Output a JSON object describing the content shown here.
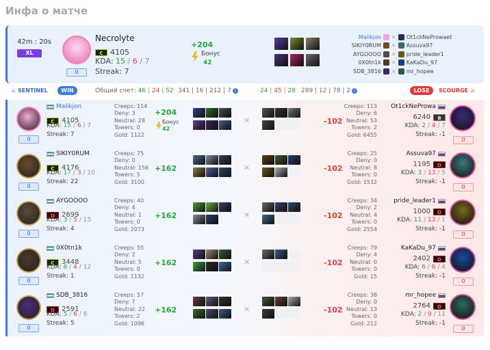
{
  "page": {
    "title": "Инфа о матче"
  },
  "summary": {
    "time": "42m : 20s",
    "badge": "XL",
    "hero": "Necrolyte",
    "rank": "C",
    "mmr": "4105",
    "kda_label": "KDA:",
    "kda_k": "15",
    "kda_d": "6",
    "kda_a": "7",
    "sep": "/",
    "streak": "Streak: 7",
    "zero": "0",
    "delta": "+204",
    "bonus_label": "Бонус",
    "bonus_value": "42",
    "colors": {
      "accent": "#3d7be0",
      "positive": "#22a83a",
      "negative": "#e23b3b",
      "xl_badge": "#7b3ee6"
    },
    "items": [
      "#5b3aa8",
      "#7c8a2a",
      "#8a7a6a",
      "#4a2e7a",
      "#b0205a",
      "#6a6a6a"
    ],
    "lineup": [
      {
        "left": "Malikjon",
        "right": "Ot1ckNeProwaet",
        "la": "#f3a9d5",
        "ra": "#2a2a5a",
        "highlight": true
      },
      {
        "left": "SIKIY0RUM",
        "right": "Assuva97",
        "la": "#6a4a2a",
        "ra": "#3a6a6a",
        "highlight": false
      },
      {
        "left": "AYGOOOO",
        "right": "pride_leader1",
        "la": "#5a4a3a",
        "ra": "#6a5a1a",
        "highlight": false
      },
      {
        "left": "0X0tn1k",
        "right": "KaKaDu_97",
        "la": "#4a3a2a",
        "ra": "#1a3a8a",
        "highlight": false
      },
      {
        "left": "SDB_3816",
        "right": "mr_hopee",
        "la": "#3a2a6a",
        "ra": "#2a5a4a",
        "highlight": false
      }
    ]
  },
  "scorebar": {
    "sentinel": "SENTINEL",
    "win": "WIN",
    "total_label": "Общий счет:",
    "s_k": "46",
    "s_d": "24",
    "s_a": "52",
    "s_totals": "341 | 16 | 212 | 7",
    "c_k": "24",
    "c_d": "45",
    "c_a": "28",
    "c_totals": "289 | 12 | 78 | 2",
    "lose": "LOSE",
    "scourge": "SCOURGE",
    "bar": "|"
  },
  "labels": {
    "creeps": "Creeps:",
    "deny": "Deny:",
    "neutral": "Neutral:",
    "towers": "Towers:",
    "gold": "Gold:",
    "kda": "KDA:",
    "streak": "Streak:",
    "bonus": "Бонус"
  },
  "players": [
    {
      "left": {
        "name": "Malikjon",
        "link": true,
        "rank": "C",
        "mmr": "4105",
        "k": "15",
        "d": "6",
        "a": "7",
        "streak": "7",
        "zero": "0",
        "creeps": "114",
        "deny": "3",
        "neutral": "28",
        "towers": "0",
        "gold": "1122",
        "delta": "+204",
        "bonus": "42",
        "avatar": "#f3a9d5",
        "items": [
          "#3a3a8a",
          "#2a6a2a",
          "#4a4a4a",
          "#6a3a8a",
          "#3a2a5a",
          "#4a5a8a"
        ]
      },
      "right": {
        "name": "Ot1ckNeProwa",
        "rank": "B",
        "mmr": "6240",
        "k": "2",
        "d": "4",
        "a": "7",
        "streak": "-1",
        "zero": "0",
        "creeps": "113",
        "deny": "6",
        "neutral": "53",
        "towers": "2",
        "gold": "6455",
        "delta": "-102",
        "avatar": "#3a2a7a",
        "items": [
          "#555555",
          "#333333",
          "#777777",
          "#444444"
        ]
      }
    },
    {
      "left": {
        "name": "SIKIY0RUM",
        "link": false,
        "rank": "C",
        "mmr": "4176",
        "k": "17",
        "d": "3",
        "a": "10",
        "streak": "22",
        "zero": "0",
        "creeps": "75",
        "deny": "0",
        "neutral": "156",
        "towers": "5",
        "gold": "3100",
        "delta": "+162",
        "avatar": "#6a4a2a",
        "items": [
          "#4a6a8a",
          "#7a8aa0",
          "#3a3a5a",
          "#8a7a3a",
          "#5a5aa0",
          "#2a4a6a"
        ]
      },
      "right": {
        "name": "Assuva97",
        "rank": "D",
        "mmr": "1195",
        "k": "3",
        "d": "13",
        "a": "5",
        "streak": "-1",
        "zero": "0",
        "creeps": "25",
        "deny": "0",
        "neutral": "8",
        "towers": "0",
        "gold": "1532",
        "delta": "-102",
        "avatar": "#3a7a7a",
        "items": [
          "#5a3a1a",
          "#3a5a2a",
          "#2a3a7a",
          "#6a5a1a",
          "#aaaaaa"
        ]
      }
    },
    {
      "left": {
        "name": "AYGOOOO",
        "link": false,
        "rank": "D",
        "mmr": "2699",
        "k": "3",
        "d": "5",
        "a": "15",
        "streak": "4",
        "zero": "0",
        "creeps": "40",
        "deny": "4",
        "neutral": "1",
        "towers": "0",
        "gold": "2073",
        "delta": "+162",
        "avatar": "#5a4a3a",
        "items": [
          "#4aa03a",
          "#6ab04a",
          "#3a3a6a",
          "#8a8a8a",
          "#2a3a6a"
        ]
      },
      "right": {
        "name": "pride_leader1",
        "rank": "D",
        "mmr": "1000",
        "k": "11",
        "d": "13",
        "a": "1",
        "streak": "-1",
        "zero": "0",
        "creeps": "34",
        "deny": "2",
        "neutral": "4",
        "towers": "0",
        "gold": "2554",
        "delta": "-102",
        "avatar": "#7a6a1a",
        "items": [
          "#6a6a6a",
          "#3a3a6a",
          "#2a4a6a",
          "#3a6a8a"
        ]
      }
    },
    {
      "left": {
        "name": "0X0tn1k",
        "link": false,
        "rank": "C",
        "mmr": "3448",
        "k": "6",
        "d": "4",
        "a": "12",
        "streak": "1",
        "zero": "0",
        "creeps": "55",
        "deny": "2",
        "neutral": "5",
        "towers": "0",
        "gold": "1132",
        "delta": "+162",
        "avatar": "#4a3a2a",
        "items": [
          "#5a3a8a",
          "#9a8a6a",
          "#3a5a3a",
          "#3aa03a",
          "#2a2a2a",
          "#3a6a9a"
        ]
      },
      "right": {
        "name": "KaKaDu_97",
        "rank": "D",
        "mmr": "2402",
        "k": "6",
        "d": "6",
        "a": "4",
        "streak": "-1",
        "zero": "0",
        "creeps": "79",
        "deny": "4",
        "neutral": "0",
        "towers": "0",
        "gold": "15",
        "delta": "-102",
        "avatar": "#1a4aa0",
        "items": [
          "#6a6a6a",
          "#3a5a8a"
        ]
      }
    },
    {
      "left": {
        "name": "SDB_3816",
        "link": false,
        "rank": "D",
        "mmr": "2591",
        "k": "5",
        "d": "6",
        "a": "8",
        "streak": "5",
        "zero": "0",
        "creeps": "57",
        "deny": "7",
        "neutral": "22",
        "towers": "2",
        "gold": "1096",
        "delta": "+162",
        "avatar": "#4a2a7a",
        "items": [
          "#6a3a3a",
          "#5a5a7a",
          "#3a2a2a",
          "#3a6a2a",
          "#4a4a6a",
          "#3a5a8a"
        ]
      },
      "right": {
        "name": "mr_hopee",
        "rank": "D",
        "mmr": "2764",
        "k": "2",
        "d": "9",
        "a": "11",
        "streak": "-1",
        "zero": "0",
        "creeps": "38",
        "deny": "0",
        "neutral": "13",
        "towers": "0",
        "gold": "212",
        "delta": "-102",
        "avatar": "#2a6a5a",
        "items": [
          "#3a5a2a",
          "#6a3a3a",
          "#aaaaaa",
          "#3a3a3a"
        ]
      }
    }
  ]
}
